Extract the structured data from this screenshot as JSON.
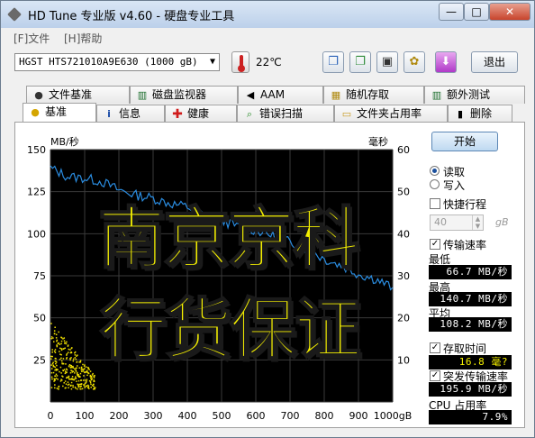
{
  "window": {
    "title": "HD Tune 专业版 v4.60 - 硬盘专业工具",
    "min": "—",
    "max": "□",
    "close": "✕"
  },
  "menu": {
    "file": "[F]文件",
    "help": "[H]帮助"
  },
  "toolbar": {
    "drive": "HGST HTS721010A9E630 (1000 gB)",
    "temperature": "22℃",
    "exit": "退出"
  },
  "tabs_top": [
    {
      "label": "文件基准",
      "icon": "info-icon"
    },
    {
      "label": "磁盘监视器",
      "icon": "chart-icon"
    },
    {
      "label": "AAM",
      "icon": "speaker-icon"
    },
    {
      "label": "随机存取",
      "icon": "grid-icon"
    },
    {
      "label": "额外测试",
      "icon": "chart-icon"
    }
  ],
  "tabs_bottom": [
    {
      "label": "基准",
      "icon": "bulb-icon",
      "active": true
    },
    {
      "label": "信息",
      "icon": "info-icon"
    },
    {
      "label": "健康",
      "icon": "plus-icon"
    },
    {
      "label": "错误扫描",
      "icon": "magnifier-icon"
    },
    {
      "label": "文件夹占用率",
      "icon": "folder-icon"
    },
    {
      "label": "删除",
      "icon": "trash-icon"
    }
  ],
  "side": {
    "start": "开始",
    "read": "读取",
    "write": "写入",
    "short_stroke": "快捷行程",
    "short_value": "40",
    "short_unit": "gB",
    "transfer": "传输速率",
    "min_label": "最低",
    "min_value": "66.7 MB/秒",
    "max_label": "最高",
    "max_value": "140.7 MB/秒",
    "avg_label": "平均",
    "avg_value": "108.2 MB/秒",
    "access_label": "存取时间",
    "access_value": "16.8 毫?",
    "burst_label": "突发传输速率",
    "burst_value": "195.9 MB/秒",
    "cpu_label": "CPU 占用率",
    "cpu_value": "7.9%"
  },
  "watermark": {
    "line1": "南京京科",
    "line2": "行货保证"
  },
  "chart_data": {
    "type": "line",
    "ylabel": "MB/秒",
    "y2label": "毫秒",
    "ylim": [
      0,
      150
    ],
    "y2lim": [
      0,
      60
    ],
    "xlim": [
      0,
      1000
    ],
    "x_ticks": [
      "0",
      "100",
      "200",
      "300",
      "400",
      "500",
      "600",
      "700",
      "800",
      "900",
      "1000gB"
    ],
    "y_ticks": [
      "150",
      "125",
      "100",
      "75",
      "50",
      "25"
    ],
    "y2_ticks": [
      "60",
      "50",
      "40",
      "30",
      "20",
      "10"
    ],
    "series": [
      {
        "name": "传输速率",
        "color": "#2a8ce0",
        "x": [
          0,
          50,
          100,
          150,
          200,
          250,
          300,
          350,
          400,
          450,
          500,
          550,
          600,
          650,
          700,
          750,
          800,
          850,
          900,
          950,
          1000
        ],
        "values": [
          139,
          134,
          133,
          131,
          126,
          123,
          121,
          118,
          116,
          111,
          108,
          104,
          102,
          99,
          95,
          91,
          85,
          81,
          76,
          73,
          68
        ]
      }
    ],
    "access_points_color": "#f0e000",
    "grid": true
  }
}
